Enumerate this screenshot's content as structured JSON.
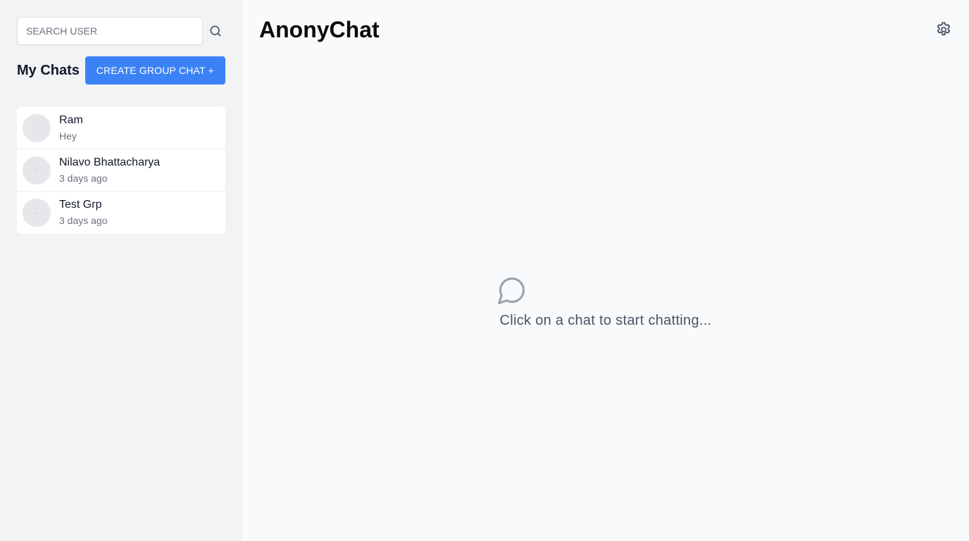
{
  "search": {
    "placeholder": "SEARCH USER",
    "icon": "search-icon"
  },
  "sidebar": {
    "title": "My Chats",
    "create_group_label": "CREATE GROUP CHAT +",
    "chats": [
      {
        "name": "Ram",
        "subtitle": "Hey"
      },
      {
        "name": "Nilavo Bhattacharya",
        "subtitle": "3 days ago"
      },
      {
        "name": "Test Grp",
        "subtitle": "3 days ago"
      }
    ]
  },
  "main": {
    "title": "AnonyChat",
    "settings_icon": "gear-icon",
    "empty_icon": "chat-bubble-icon",
    "empty_text": "Click on a chat to start chatting..."
  },
  "colors": {
    "accent": "#3b82f6",
    "sidebar_bg": "#f1f3f5",
    "main_bg": "#f8fafc"
  }
}
